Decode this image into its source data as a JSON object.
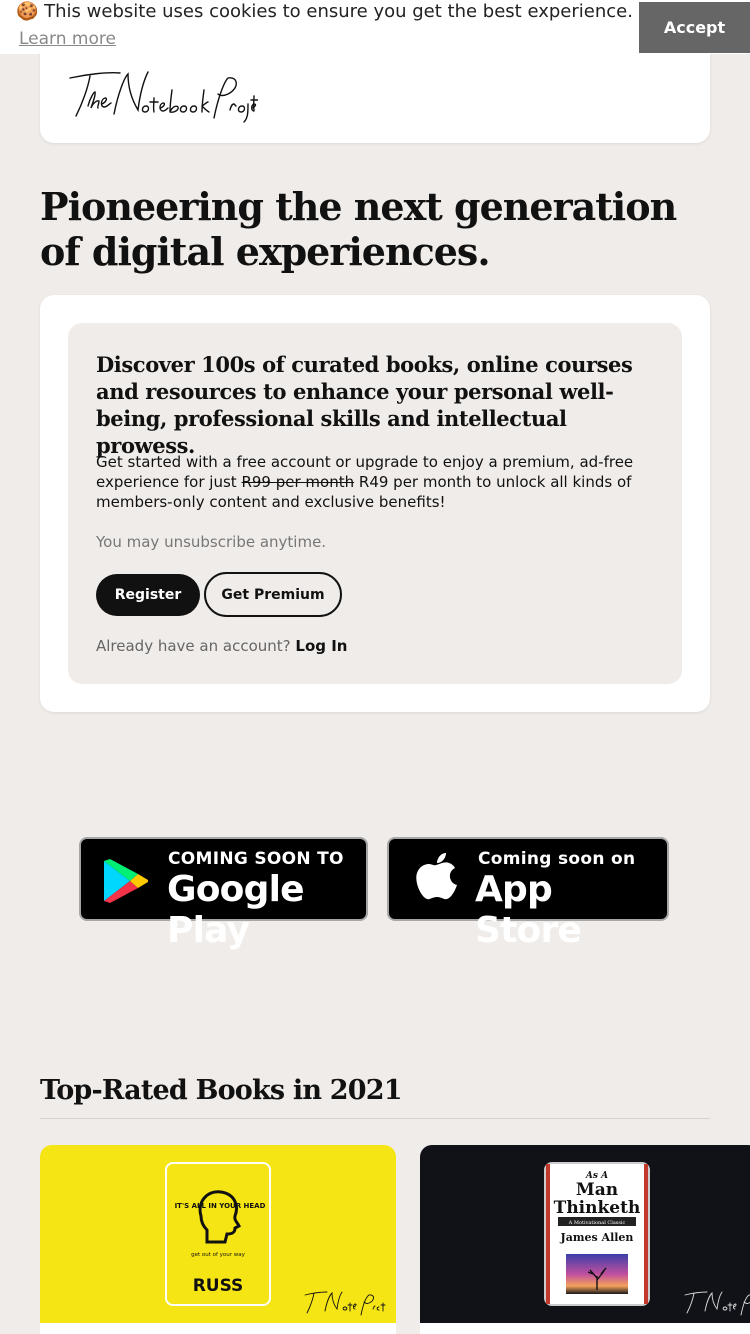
{
  "cookie": {
    "emoji": "🍪",
    "message": "This website uses cookies to ensure you get the best experience.",
    "learn_more": "Learn more",
    "accept": "Accept"
  },
  "brand": {
    "logo_text": "The Notebook Project"
  },
  "hero": {
    "headline": "Pioneering the next generation of digital experiences."
  },
  "promo": {
    "title": "Discover 100s of curated books, online courses and resources to enhance your personal well-being, professional skills and intellectual prowess.",
    "body_part1": "Get started with a free account or upgrade to enjoy a premium, ad-free experience for just",
    "old_price": "R99 per month",
    "body_part2": "R49 per month to unlock all kinds of members-only content and exclusive benefits!",
    "unsubscribe": "You may unsubscribe anytime.",
    "register": "Register",
    "premium": "Get Premium",
    "login_prompt": "Already have an account?",
    "login": "Log In"
  },
  "stores": {
    "google_small": "COMING SOON TO",
    "google_big": "Google Play",
    "apple_small": "Coming soon on",
    "apple_big": "App Store"
  },
  "books_section": {
    "title": "Top-Rated Books in 2021",
    "books": [
      {
        "card_color": "#f5e514",
        "cover_top": "IT'S ALL IN YOUR HEAD",
        "cover_tagline": "get out of your way",
        "cover_author": "RUSS"
      },
      {
        "card_color": "#111217",
        "cover_small": "As A",
        "cover_title_1": "Man",
        "cover_title_2": "Thinketh",
        "cover_subtitle": "A Motivational Classic",
        "cover_author": "James Allen"
      }
    ]
  },
  "colors": {
    "background": "#f0ece9",
    "accent_dark": "#111111",
    "accept_bg": "#666666"
  }
}
